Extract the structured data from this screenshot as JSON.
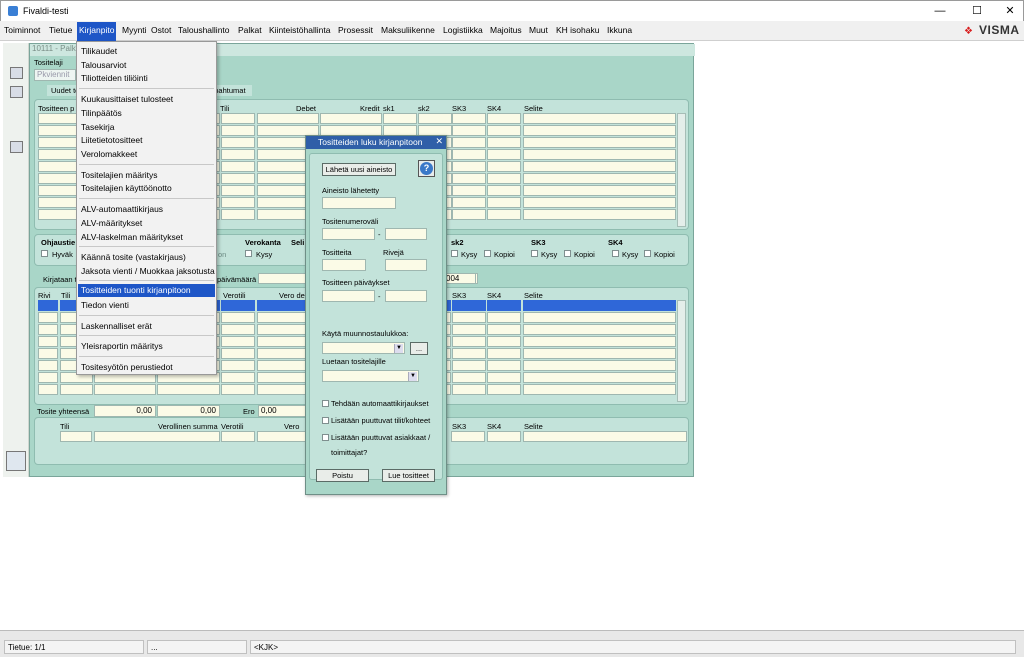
{
  "app": {
    "title": "Fivaldi-testi",
    "brand": "VISMA"
  },
  "window_controls": {
    "minimize": "—",
    "maximize": "☐",
    "close": "✕"
  },
  "menubar": [
    "Toiminnot",
    "Tietue",
    "Kirjanpito",
    "Myynti",
    "Ostot",
    "Taloushallinto",
    "Palkat",
    "Kiinteistöhallinta",
    "Prosessit",
    "Maksuliikenne",
    "Logistiikka",
    "Majoitus",
    "Muut",
    "KH isohaku",
    "Ikkuna"
  ],
  "dropdown": {
    "items": [
      "Tilikaudet",
      "Talousarviot",
      "Tiliotteiden tiliöinti",
      "Kuukausittaiset tulosteet",
      "Tilinpäätös",
      "Tasekirja",
      "Liitetietotositteet",
      "Verolomakkeet",
      "Tositelajien määritys",
      "Tositelajien käyttöönotto",
      "ALV-automaattikirjaus",
      "ALV-määritykset",
      "ALV-laskelman määritykset",
      "Käännä tosite (vastakirjaus)",
      "Jaksota vienti / Muokkaa jaksotusta",
      "Tositteiden tuonti kirjanpitoon",
      "Tiedon vienti",
      "Laskennalliset erät",
      "Yleisraportin määritys",
      "Tositesyötön perustiedot"
    ],
    "highlighted": "Tositteiden tuonti kirjanpitoon"
  },
  "innerwin": {
    "title": "10111 - Palkka",
    "tositelaji_label": "Tositelaji",
    "tositelaji_value": "Pkviennit",
    "tab_uudet": "Uudet to",
    "tab_tapahtumat": "tapahtumat",
    "grid1_headers": {
      "tositteen": "Tositteen p",
      "tili": "Tili",
      "debet": "Debet",
      "kredit": "Kredit",
      "sk1": "sk1",
      "sk2": "sk2",
      "sk3": "SK3",
      "sk4": "SK4",
      "selite": "Selite"
    },
    "ohjaus": {
      "label": "Ohjaustie",
      "hyvak": "Hyväk",
      "on": "on",
      "verokanta": "Verokanta",
      "seli": "Seli",
      "kysy": "Kysy",
      "sk2": "sk2",
      "sk3": "SK3",
      "sk4": "SK4",
      "kysy_label": "Kysy",
      "kopioi_label": "Kopioi"
    },
    "kirjataan": "Kirjataan t",
    "paivamaara": "päivämäärä",
    "year_fragment": "004",
    "grid2_headers": {
      "rivi": "Rivi",
      "tili": "Tili",
      "verotili": "Verotili",
      "verode": "Vero de",
      "sk3": "SK3",
      "sk4": "SK4",
      "selite": "Selite"
    },
    "totals": {
      "label": "Tosite yhteensä",
      "v1": "0,00",
      "v2": "0,00",
      "ero_label": "Ero",
      "ero": "0,00"
    },
    "bottom_headers": {
      "tili": "Tili",
      "verollinen": "Verollinen summa",
      "verotili": "Verotili",
      "vero": "Vero",
      "sk3": "SK3",
      "sk4": "SK4",
      "selite": "Selite"
    }
  },
  "dialog": {
    "title": "Tositteiden luku kirjanpitoon",
    "send_button": "Lähetä uusi aineisto",
    "help": "?",
    "aineisto_label": "Aineisto lähetetty",
    "numero_label": "Tositenumeroväli",
    "dash": "-",
    "tositteita_label": "Tositteita",
    "riveja_label": "Rivejä",
    "paivays_label": "Tositteen päiväykset",
    "muunnos_label": "Käytä muunnostaulukkoa:",
    "browse": "...",
    "luetaan_label": "Luetaan tositelajille",
    "cb1": "Tehdään automaattikirjaukset",
    "cb2": "Lisätään puuttuvat tilit/kohteet",
    "cb3a": "Lisätään puuttuvat asiakkaat /",
    "cb3b": "toimittajat?",
    "btn_poistu": "Poistu",
    "btn_lue": "Lue tositteet"
  },
  "statusbar": {
    "tietue": "Tietue: 1/1",
    "ellipsis": "...",
    "kjk": "<KJK>"
  }
}
